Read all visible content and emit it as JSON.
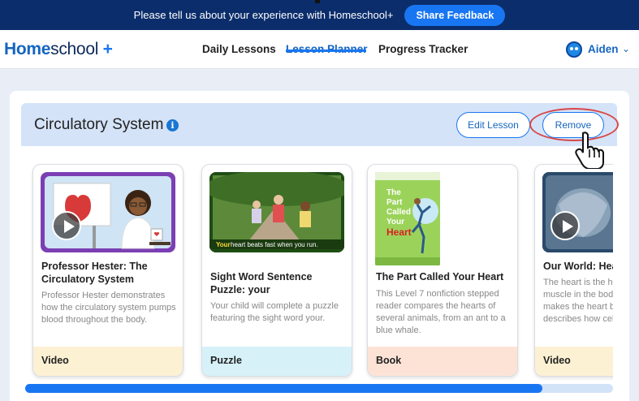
{
  "banner": {
    "message": "Please tell us about your experience with Homeschool+",
    "button_label": "Share Feedback"
  },
  "nav": {
    "logo_home": "Home",
    "logo_school": "school",
    "logo_plus": "+",
    "links": [
      "Daily Lessons",
      "Lesson Planner",
      "Progress Tracker"
    ],
    "active_link": "Lesson Planner",
    "user_name": "Aiden",
    "chevron": "⌄"
  },
  "lesson": {
    "title": "Circulatory System",
    "info_icon_glyph": "i",
    "edit_label": "Edit Lesson",
    "remove_label": "Remove"
  },
  "cards": [
    {
      "title": "Professor Hester: The\nCirculatory System",
      "description": "Professor Hester demonstrates how the circulatory system pumps blood throughout the body.",
      "type": "Video",
      "type_color": "#fdf1d3",
      "icon": "play-icon"
    },
    {
      "title": "Sight Word Sentence\nPuzzle: your",
      "description": "Your child will complete a puzzle featuring the sight word your.",
      "type": "Puzzle",
      "type_color": "#d7f1f9",
      "caption_word": "Your",
      "caption_rest": " heart beats fast when you run."
    },
    {
      "title": "The Part Called Your Heart",
      "description": "This Level 7 nonfiction stepped reader compares the hearts of several animals, from an ant to a blue whale.",
      "type": "Book",
      "type_color": "#fde3d6",
      "book_title_line1": "The",
      "book_title_line2": "Part",
      "book_title_line3": "Called",
      "book_title_line4": "Your",
      "book_title_line5": "Heart"
    },
    {
      "title": "Our World: Heart",
      "description": "The heart is the hardest working muscle in the body. But what makes the heart beat? This video describes how cells pump blood.",
      "type": "Video",
      "type_color": "#fdf1d3",
      "icon": "play-icon"
    }
  ],
  "scrollbar": {
    "progress": 0.88
  }
}
